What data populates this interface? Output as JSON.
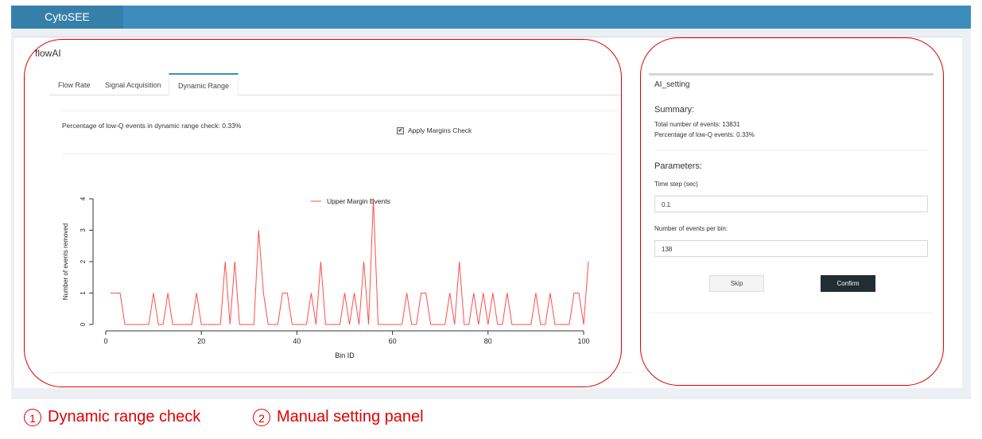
{
  "app": {
    "title": "CytoSEE"
  },
  "box": {
    "title": "flowAI"
  },
  "tabs": [
    {
      "label": "Flow Rate"
    },
    {
      "label": "Signal Acquisition"
    },
    {
      "label": "Dynamic Range"
    }
  ],
  "dynamic_range": {
    "summary": "Percentage of low-Q events in dynamic range check: 0.33%",
    "checkbox_label": "Apply Margins Check",
    "checkbox_checked": true
  },
  "chart_data": {
    "type": "line",
    "title": "",
    "xlabel": "Bin ID",
    "ylabel": "Number of events removed",
    "xlim": [
      0,
      101
    ],
    "ylim": [
      0,
      4
    ],
    "xticks": [
      0,
      20,
      40,
      60,
      80,
      100
    ],
    "yticks": [
      0,
      1,
      2,
      3,
      4
    ],
    "legend_position": "top-center",
    "series": [
      {
        "name": "Upper Margin Events",
        "color": "#ff4d4d",
        "x": [
          1,
          2,
          3,
          4,
          5,
          6,
          7,
          8,
          9,
          10,
          11,
          12,
          13,
          14,
          15,
          16,
          17,
          18,
          19,
          20,
          21,
          22,
          23,
          24,
          25,
          26,
          27,
          28,
          29,
          30,
          31,
          32,
          33,
          34,
          35,
          36,
          37,
          38,
          39,
          40,
          41,
          42,
          43,
          44,
          45,
          46,
          47,
          48,
          49,
          50,
          51,
          52,
          53,
          54,
          55,
          56,
          57,
          58,
          59,
          60,
          61,
          62,
          63,
          64,
          65,
          66,
          67,
          68,
          69,
          70,
          71,
          72,
          73,
          74,
          75,
          76,
          77,
          78,
          79,
          80,
          81,
          82,
          83,
          84,
          85,
          86,
          87,
          88,
          89,
          90,
          91,
          92,
          93,
          94,
          95,
          96,
          97,
          98,
          99,
          100,
          101
        ],
        "y": [
          1,
          1,
          1,
          0,
          0,
          0,
          0,
          0,
          0,
          1,
          0,
          0,
          1,
          0,
          0,
          0,
          0,
          0,
          1,
          0,
          0,
          0,
          0,
          0,
          2,
          0,
          2,
          0,
          0,
          0,
          0,
          3,
          1,
          0,
          0,
          0,
          1,
          1,
          0,
          0,
          0,
          0,
          1,
          0,
          2,
          0,
          0,
          0,
          0,
          1,
          0,
          1,
          0,
          2,
          0,
          4,
          0,
          0,
          0,
          0,
          0,
          0,
          1,
          0,
          0,
          1,
          1,
          0,
          0,
          0,
          0,
          1,
          0,
          2,
          0,
          0,
          1,
          0,
          1,
          0,
          1,
          0,
          0,
          1,
          0,
          0,
          0,
          0,
          0,
          1,
          0,
          0,
          1,
          0,
          0,
          0,
          0,
          1,
          1,
          0,
          2
        ]
      }
    ]
  },
  "panel": {
    "title": "AI_setting",
    "summary_heading": "Summary:",
    "total_events": "Total number of events: 13831",
    "low_q_pct": "Percentage of low-Q events: 0.33%",
    "params_heading": "Parameters:",
    "time_step_label": "Time step (sec)",
    "time_step_value": "0.1",
    "events_per_bin_label": "Number of events per bin:",
    "events_per_bin_value": "138",
    "skip_label": "Skip",
    "confirm_label": "Confirm"
  },
  "annotations": [
    {
      "num": "1",
      "text": "Dynamic range check"
    },
    {
      "num": "2",
      "text": "Manual setting panel"
    }
  ],
  "colors": {
    "header": "#3c8dbc",
    "brand": "#367fa9",
    "annotation": "#e00000",
    "confirm": "#222d32"
  }
}
